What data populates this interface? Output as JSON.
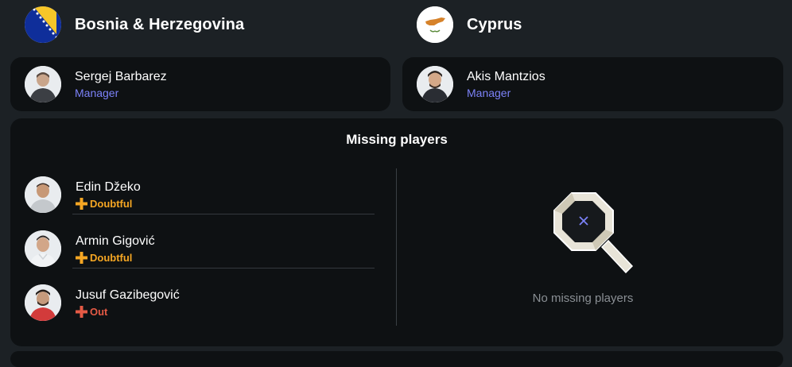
{
  "home": {
    "team_name": "Bosnia & Herzegovina",
    "manager": {
      "name": "Sergej Barbarez",
      "role": "Manager"
    }
  },
  "away": {
    "team_name": "Cyprus",
    "manager": {
      "name": "Akis Mantzios",
      "role": "Manager"
    }
  },
  "missing": {
    "title": "Missing players",
    "home_players": [
      {
        "name": "Edin Džeko",
        "status": "Doubtful",
        "status_color": "#f5a623"
      },
      {
        "name": "Armin Gigović",
        "status": "Doubtful",
        "status_color": "#f5a623"
      },
      {
        "name": "Jusuf Gazibegović",
        "status": "Out",
        "status_color": "#e55a45"
      }
    ],
    "away_empty_text": "No missing players"
  },
  "colors": {
    "background": "#1c2125",
    "card": "#0e1113",
    "role": "#7c82f8",
    "doubtful": "#f5a623",
    "out": "#e55a45",
    "muted": "#8a8f94"
  },
  "icons": {
    "home_flag": "bosnia-flag-icon",
    "away_flag": "cyprus-flag-icon",
    "empty": "magnifier-icon"
  }
}
